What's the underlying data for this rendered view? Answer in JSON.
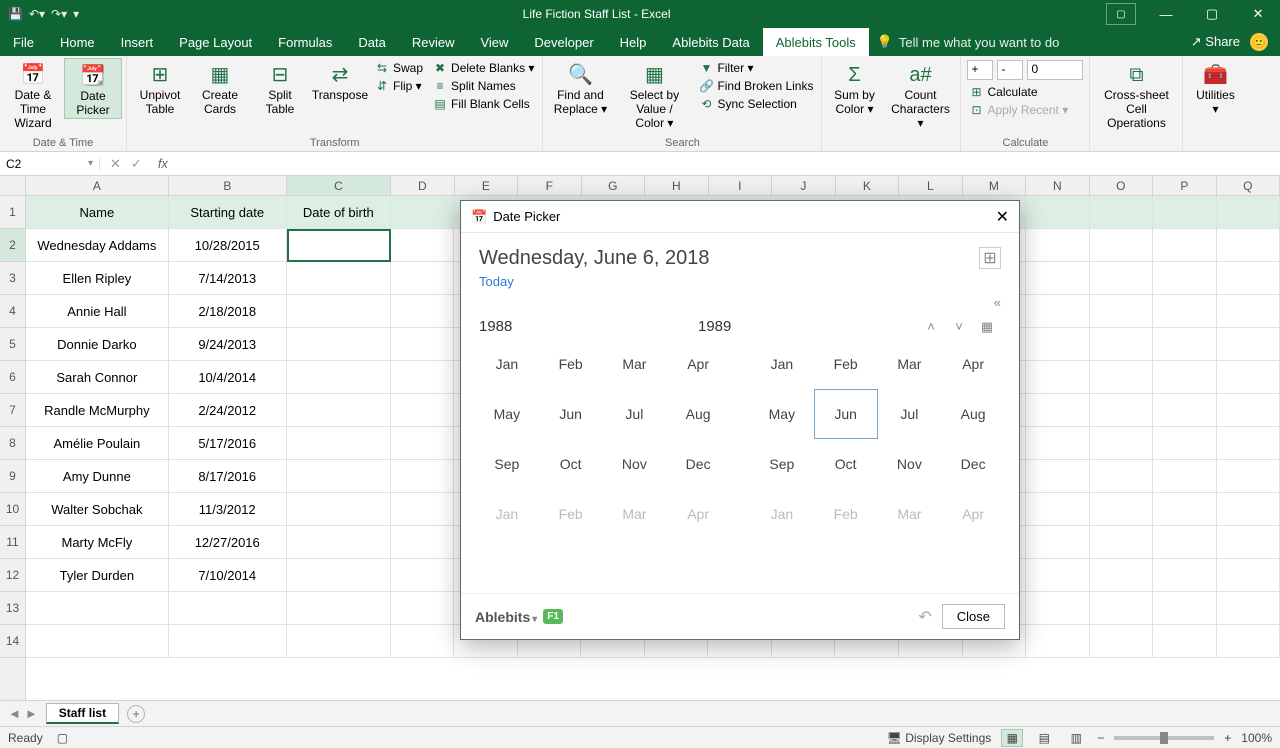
{
  "titlebar": {
    "title": "Life Fiction Staff List - Excel"
  },
  "tabs": [
    "File",
    "Home",
    "Insert",
    "Page Layout",
    "Formulas",
    "Data",
    "Review",
    "View",
    "Developer",
    "Help",
    "Ablebits Data",
    "Ablebits Tools"
  ],
  "active_tab": "Ablebits Tools",
  "tell_me": "Tell me what you want to do",
  "share": "Share",
  "ribbon": {
    "date_time": {
      "label": "Date & Time",
      "btns": [
        {
          "t": "Date & Time Wizard"
        },
        {
          "t": "Date Picker"
        }
      ]
    },
    "transform": {
      "label": "Transform",
      "big": [
        "Unpivot Table",
        "Create Cards",
        "Split Table",
        "Transpose"
      ],
      "sm": [
        "Swap",
        "Flip ▾",
        "Delete Blanks ▾",
        "Split Names",
        "Fill Blank Cells"
      ]
    },
    "search": {
      "label": "Search",
      "big": [
        "Find and Replace ▾",
        "Select by Value / Color ▾"
      ],
      "sm": [
        "Filter ▾",
        "Find Broken Links",
        "Sync Selection"
      ]
    },
    "sumcount": {
      "big": [
        "Sum by Color ▾",
        "Count Characters ▾"
      ]
    },
    "calculate": {
      "label": "Calculate",
      "plus": "+",
      "minus": "-",
      "val": "0",
      "sm": [
        "Calculate",
        "Apply Recent ▾"
      ]
    },
    "cross": {
      "t": "Cross-sheet Cell Operations"
    },
    "util": {
      "t": "Utilities ▾"
    }
  },
  "namebox": "C2",
  "columns": [
    "A",
    "B",
    "C",
    "D",
    "E",
    "F",
    "G",
    "H",
    "I",
    "J",
    "K",
    "L",
    "M",
    "N",
    "O",
    "P",
    "Q"
  ],
  "col_widths": [
    "wA",
    "wB",
    "wC",
    "wSm",
    "wSm",
    "wSm",
    "wSm",
    "wSm",
    "wSm",
    "wSm",
    "wSm",
    "wSm",
    "wSm",
    "wSm",
    "wSm",
    "wSm",
    "wSm"
  ],
  "headers": [
    "Name",
    "Starting date",
    "Date of birth"
  ],
  "rows": [
    {
      "n": "Wednesday Addams",
      "d": "10/28/2015"
    },
    {
      "n": "Ellen Ripley",
      "d": "7/14/2013"
    },
    {
      "n": "Annie Hall",
      "d": "2/18/2018"
    },
    {
      "n": "Donnie Darko",
      "d": "9/24/2013"
    },
    {
      "n": "Sarah Connor",
      "d": "10/4/2014"
    },
    {
      "n": "Randle McMurphy",
      "d": "2/24/2012"
    },
    {
      "n": "Amélie Poulain",
      "d": "5/17/2016"
    },
    {
      "n": "Amy Dunne",
      "d": "8/17/2016"
    },
    {
      "n": "Walter Sobchak",
      "d": "11/3/2012"
    },
    {
      "n": "Marty McFly",
      "d": "12/27/2016"
    },
    {
      "n": "Tyler Durden",
      "d": "7/10/2014"
    }
  ],
  "sel_row": 2,
  "sel_col": "C",
  "sheet": "Staff list",
  "status": {
    "ready": "Ready",
    "display": "Display Settings",
    "zoom": "100%"
  },
  "dialog": {
    "title": "Date Picker",
    "date": "Wednesday, June 6, 2018",
    "today": "Today",
    "years": [
      "1988",
      "1989"
    ],
    "months_base": [
      "Jan",
      "Feb",
      "Mar",
      "Apr",
      "May",
      "Jun",
      "Jul",
      "Aug",
      "Sep",
      "Oct",
      "Nov",
      "Dec"
    ],
    "months_dim": [
      "Jan",
      "Feb",
      "Mar",
      "Apr"
    ],
    "selected_month": "Jun",
    "brand": "Ablebits",
    "f1": "F1",
    "close": "Close"
  }
}
